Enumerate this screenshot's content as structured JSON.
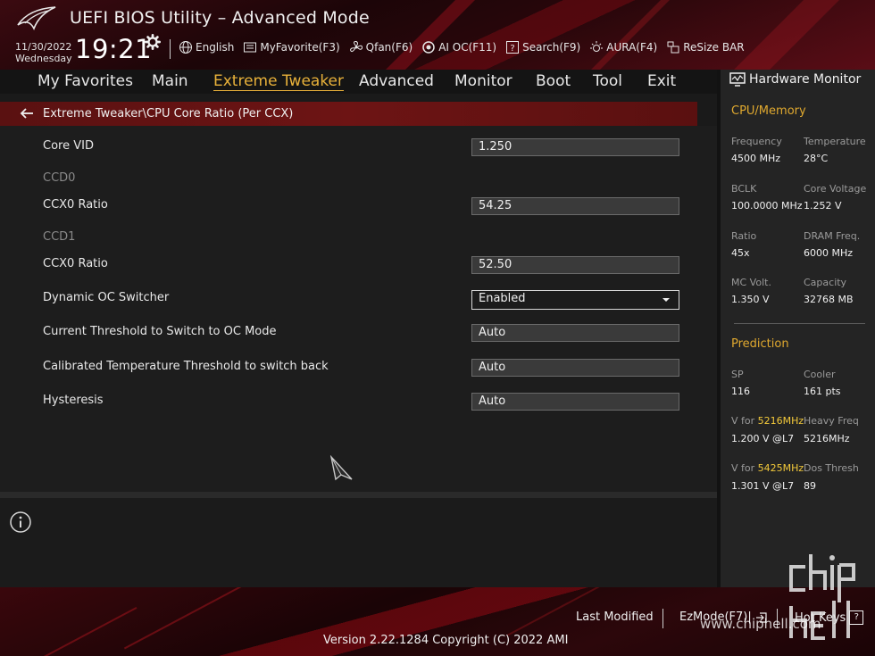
{
  "header": {
    "title": "UEFI BIOS Utility – Advanced Mode",
    "date": "11/30/2022",
    "weekday": "Wednesday",
    "time": "19:21",
    "toolbar": [
      {
        "label": "English",
        "icon": "globe-icon"
      },
      {
        "label": "MyFavorite(F3)",
        "icon": "favorite-icon"
      },
      {
        "label": "Qfan(F6)",
        "icon": "fan-icon"
      },
      {
        "label": "AI OC(F11)",
        "icon": "ai-oc-icon"
      },
      {
        "label": "Search(F9)",
        "icon": "search-icon"
      },
      {
        "label": "AURA(F4)",
        "icon": "aura-icon"
      },
      {
        "label": "ReSize BAR",
        "icon": "resize-bar-icon"
      }
    ]
  },
  "menu": {
    "items": [
      "My Favorites",
      "Main",
      "Extreme Tweaker",
      "Advanced",
      "Monitor",
      "Boot",
      "Tool",
      "Exit"
    ],
    "active": "Extreme Tweaker"
  },
  "breadcrumb": "Extreme Tweaker\\CPU Core Ratio (Per CCX)",
  "settings": [
    {
      "label": "Core VID",
      "value": "1.250"
    },
    {
      "label": "CCD0"
    },
    {
      "label": "CCX0 Ratio",
      "value": "54.25"
    },
    {
      "label": "CCD1"
    },
    {
      "label": "CCX0 Ratio",
      "value": "52.50"
    },
    {
      "label": "Dynamic OC Switcher",
      "value": "Enabled"
    },
    {
      "label": "Current Threshold to Switch to OC Mode",
      "value": "Auto"
    },
    {
      "label": "Calibrated Temperature Threshold to switch back",
      "value": "Auto"
    },
    {
      "label": "Hysteresis",
      "value": "Auto"
    }
  ],
  "hw_monitor": {
    "title": "Hardware Monitor",
    "cpu_memory": {
      "heading": "CPU/Memory",
      "frequency": {
        "label": "Frequency",
        "value": "4500 MHz"
      },
      "temperature": {
        "label": "Temperature",
        "value": "28°C"
      },
      "bclk": {
        "label": "BCLK",
        "value": "100.0000 MHz"
      },
      "core_voltage": {
        "label": "Core Voltage",
        "value": "1.252 V"
      },
      "ratio": {
        "label": "Ratio",
        "value": "45x"
      },
      "dram_freq": {
        "label": "DRAM Freq.",
        "value": "6000 MHz"
      },
      "mc_volt": {
        "label": "MC Volt.",
        "value": "1.350 V"
      },
      "capacity": {
        "label": "Capacity",
        "value": "32768 MB"
      }
    },
    "prediction": {
      "heading": "Prediction",
      "sp": {
        "label": "SP",
        "value": "116"
      },
      "cooler": {
        "label": "Cooler",
        "value": "161 pts"
      },
      "v_for_1": {
        "label": "V for",
        "freq": "5216MHz",
        "value": "1.200 V @L7"
      },
      "heavy_freq": {
        "label": "Heavy Freq",
        "value": "5216MHz"
      },
      "v_for_2": {
        "label": "V for",
        "freq": "5425MHz",
        "value": "1.301 V @L7"
      },
      "dos_thresh": {
        "label": "Dos Thresh",
        "value": "89"
      }
    }
  },
  "footer": {
    "last_modified": "Last Modified",
    "ezmode": "EzMode(F7)|",
    "hotkeys": "Hot Keys",
    "hotkeys_key": "?",
    "version": "Version 2.22.1284 Copyright (C) 2022 AMI"
  },
  "watermark": {
    "text": "chip hell",
    "url": "www.chiphell.com"
  },
  "colors": {
    "accent": "#e8b13a",
    "brand_red": "#6d1414",
    "highlight": "#f3c93a"
  }
}
